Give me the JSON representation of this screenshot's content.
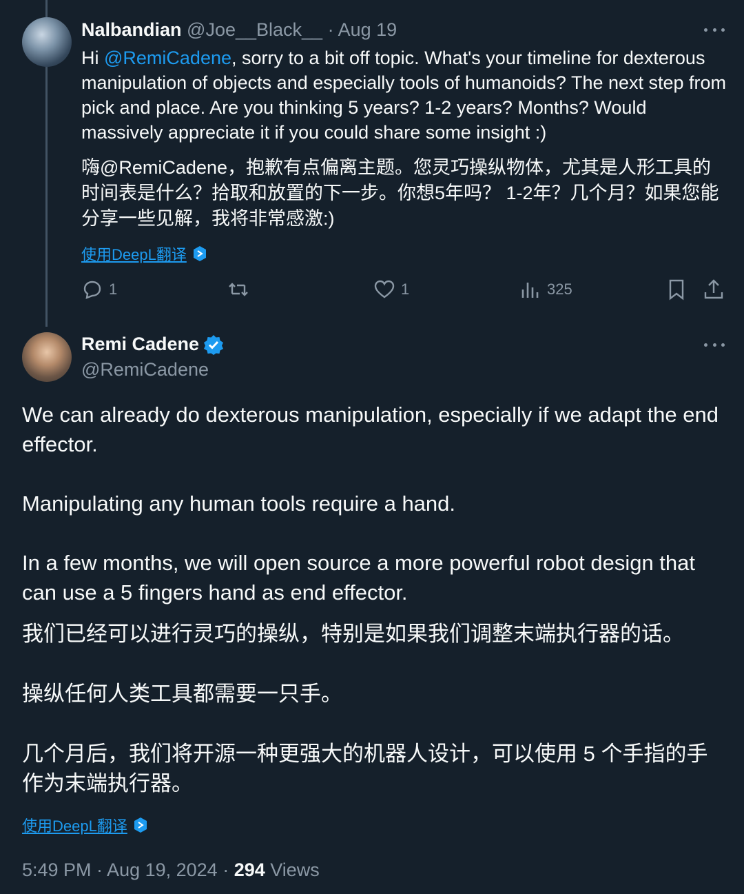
{
  "reply": {
    "display_name": "Nalbandian",
    "handle": "@Joe__Black__",
    "date": "· Aug 19",
    "text_prefix": "Hi ",
    "mention": "@RemiCadene",
    "text_rest": ", sorry to a bit off topic. What's your timeline for dexterous manipulation of objects and especially tools of humanoids? The next step from pick and place. Are you thinking 5 years? 1-2 years? Months? Would massively appreciate it if you could share some insight :)",
    "translation": "嗨@RemiCadene，抱歉有点偏离主题。您灵巧操纵物体，尤其是人形工具的时间表是什么？拾取和放置的下一步。你想5年吗？ 1-2年？几个月？如果您能分享一些见解，我将非常感激:)",
    "translate_link": "使用DeepL翻译",
    "reply_count": "1",
    "like_count": "1",
    "view_count": "325"
  },
  "main": {
    "display_name": "Remi Cadene",
    "handle": "@RemiCadene",
    "paragraphs": [
      "We can already do dexterous manipulation, especially if we adapt the end effector.",
      "Manipulating any human tools require a hand.",
      "In a few months, we will open source a more powerful robot design that can use a 5 fingers hand as end effector."
    ],
    "translation": [
      "我们已经可以进行灵巧的操纵，特别是如果我们调整末端执行器的话。",
      "操纵任何人类工具都需要一只手。",
      "几个月后，我们将开源一种更强大的机器人设计，可以使用 5 个手指的手作为末端执行器。"
    ],
    "translate_link": "使用DeepL翻译",
    "timestamp": "5:49 PM · Aug 19, 2024 · ",
    "views_count": "294",
    "views_label": " Views"
  },
  "colors": {
    "background": "#15202b",
    "accent": "#1d9bf0",
    "muted": "#8b98a5",
    "verified": "#1d9bf0"
  },
  "icons": [
    "reply-icon",
    "retweet-icon",
    "like-icon",
    "views-icon",
    "bookmark-icon",
    "share-icon",
    "verified-badge-icon",
    "deepl-icon",
    "more-icon"
  ]
}
